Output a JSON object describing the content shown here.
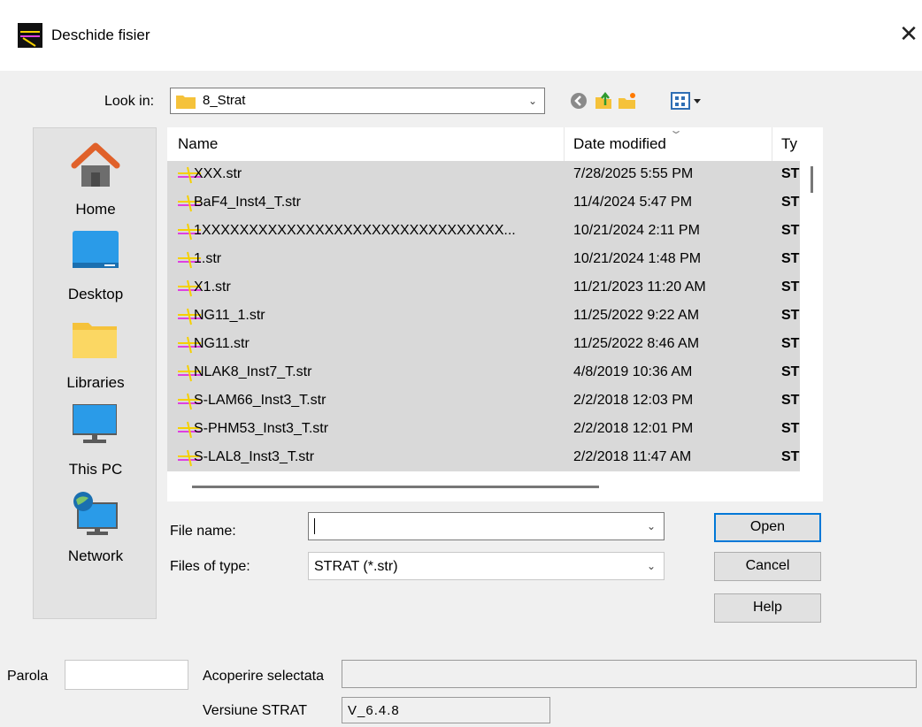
{
  "window": {
    "title": "Deschide fisier",
    "close_glyph": "✕"
  },
  "look_in": {
    "label": "Look in:",
    "value": "8_Strat"
  },
  "toolbar": {
    "icons": [
      "back-icon",
      "up-folder-icon",
      "new-folder-icon",
      "view-menu-icon"
    ]
  },
  "places": [
    {
      "label": "Home",
      "icon": "home-icon"
    },
    {
      "label": "Desktop",
      "icon": "desktop-icon"
    },
    {
      "label": "Libraries",
      "icon": "libraries-icon"
    },
    {
      "label": "This PC",
      "icon": "this-pc-icon"
    },
    {
      "label": "Network",
      "icon": "network-icon"
    }
  ],
  "file_list": {
    "columns": [
      "Name",
      "Date modified",
      "Ty"
    ],
    "rows": [
      {
        "name": "XXX.str",
        "date": "7/28/2025 5:55 PM",
        "type": "ST"
      },
      {
        "name": "BaF4_Inst4_T.str",
        "date": "11/4/2024 5:47 PM",
        "type": "ST"
      },
      {
        "name": "1XXXXXXXXXXXXXXXXXXXXXXXXXXXXXXXX...",
        "date": "10/21/2024 2:11 PM",
        "type": "ST"
      },
      {
        "name": "1.str",
        "date": "10/21/2024 1:48 PM",
        "type": "ST"
      },
      {
        "name": "X1.str",
        "date": "11/21/2023 11:20 AM",
        "type": "ST"
      },
      {
        "name": "NG11_1.str",
        "date": "11/25/2022 9:22 AM",
        "type": "ST"
      },
      {
        "name": "NG11.str",
        "date": "11/25/2022 8:46 AM",
        "type": "ST"
      },
      {
        "name": "NLAK8_Inst7_T.str",
        "date": "4/8/2019 10:36 AM",
        "type": "ST"
      },
      {
        "name": "S-LAM66_Inst3_T.str",
        "date": "2/2/2018 12:03 PM",
        "type": "ST"
      },
      {
        "name": "S-PHM53_Inst3_T.str",
        "date": "2/2/2018 12:01 PM",
        "type": "ST"
      },
      {
        "name": "S-LAL8_Inst3_T.str",
        "date": "2/2/2018 11:47 AM",
        "type": "ST"
      }
    ]
  },
  "file_name": {
    "label": "File name:",
    "value": ""
  },
  "file_type": {
    "label": "Files of type:",
    "value": "STRAT (*.str)"
  },
  "buttons": {
    "open": "Open",
    "cancel": "Cancel",
    "help": "Help"
  },
  "extra": {
    "password_label": "Parola",
    "password_value": "",
    "selected_coating_label": "Acoperire selectata",
    "selected_coating_value": "",
    "version_label": "Versiune STRAT",
    "version_value": "V_6.4.8"
  },
  "colors": {
    "accent": "#0078d7",
    "folder": "#f5c23a",
    "list_bg": "#d9d9d9"
  }
}
